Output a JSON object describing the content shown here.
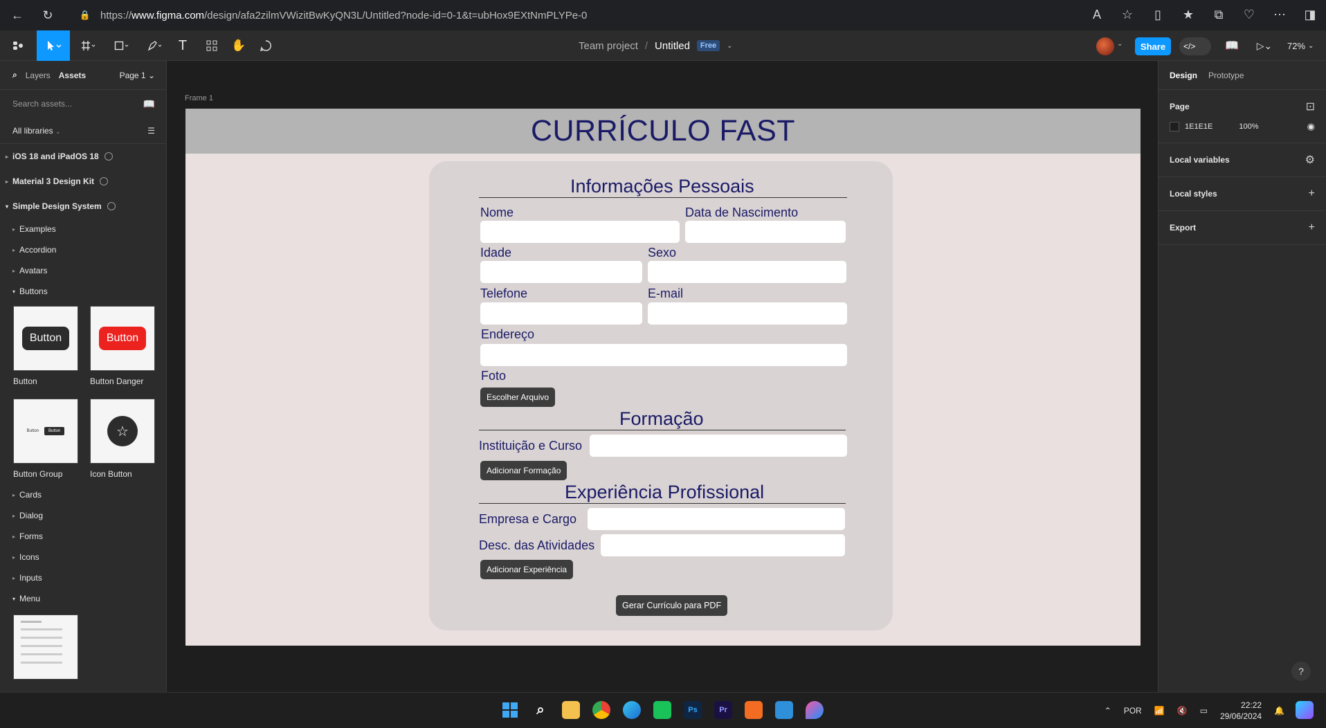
{
  "browser": {
    "url_prefix": "https://",
    "url_host": "www.figma.com",
    "url_path": "/design/afa2zilmVWizitBwKyQN3L/Untitled?node-id=0-1&t=ubHox9EXtNmPLYPe-0"
  },
  "toolbar": {
    "team": "Team project",
    "separator": "/",
    "file_name": "Untitled",
    "plan_badge": "Free",
    "share_label": "Share",
    "zoom": "72%"
  },
  "left_panel": {
    "tab_layers": "Layers",
    "tab_assets": "Assets",
    "page_selector": "Page 1",
    "search_placeholder": "Search assets...",
    "libraries_filter": "All libraries",
    "libraries": [
      "iOS 18 and iPadOS 18",
      "Material 3 Design Kit",
      "Simple Design System"
    ],
    "groups_before": [
      "Examples",
      "Accordion",
      "Avatars"
    ],
    "buttons_group": "Buttons",
    "button_thumbs": [
      {
        "label": "Button",
        "preview": "Button"
      },
      {
        "label": "Button Danger",
        "preview": "Button"
      },
      {
        "label": "Button Group",
        "preview": "Button"
      },
      {
        "label": "Icon Button",
        "preview": ""
      }
    ],
    "groups_after": [
      "Cards",
      "Dialog",
      "Forms",
      "Icons",
      "Inputs"
    ],
    "menu_group": "Menu"
  },
  "canvas": {
    "frame_label": "Frame 1",
    "title": "CURRÍCULO FAST",
    "personal_title": "Informações Pessoais",
    "fields": {
      "nome": "Nome",
      "nascimento": "Data de Nascimento",
      "idade": "Idade",
      "sexo": "Sexo",
      "telefone": "Telefone",
      "email": "E-mail",
      "endereco": "Endereço",
      "foto": "Foto"
    },
    "choose_file": "Escolher Arquivo",
    "education_title": "Formação",
    "institution_label": "Instituição e Curso",
    "add_education": "Adicionar Formação",
    "experience_title": "Experiência Profissional",
    "company_label": "Empresa e Cargo",
    "activities_label": "Desc. das Atividades",
    "add_experience": "Adicionar Experiência",
    "generate_pdf": "Gerar Currículo para PDF"
  },
  "right_panel": {
    "tab_design": "Design",
    "tab_prototype": "Prototype",
    "page_heading": "Page",
    "page_color": "1E1E1E",
    "page_opacity": "100%",
    "local_variables": "Local variables",
    "local_styles": "Local styles",
    "export": "Export"
  },
  "taskbar": {
    "language": "POR",
    "time": "22:22",
    "date": "29/06/2024"
  },
  "colors": {
    "accent": "#0d99ff",
    "title_navy": "#1a1a66",
    "frame_bg": "#eae0e0",
    "card_bg": "#d9d3d3",
    "header_gray": "#b4b4b4"
  }
}
